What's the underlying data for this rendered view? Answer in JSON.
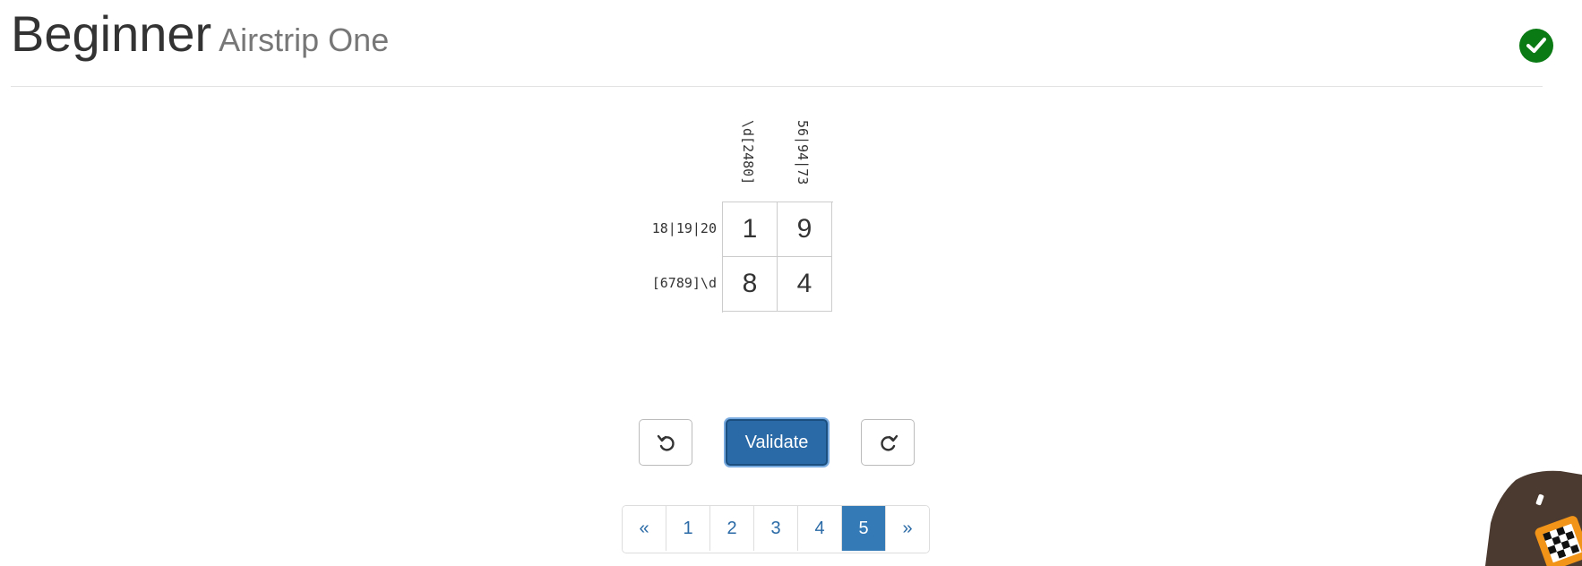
{
  "header": {
    "title": "Beginner",
    "subtitle": "Airstrip One",
    "status_icon": "check-circle-icon",
    "status_color": "#0a7a14"
  },
  "puzzle": {
    "col_clues": [
      "\\d[2480]",
      "56|94|73"
    ],
    "row_clues": [
      "18|19|20",
      "[6789]\\d"
    ],
    "cells": [
      [
        "1",
        "9"
      ],
      [
        "8",
        "4"
      ]
    ]
  },
  "controls": {
    "undo_icon": "undo-icon",
    "validate_label": "Validate",
    "redo_icon": "redo-icon"
  },
  "pagination": {
    "prev": "«",
    "pages": [
      "1",
      "2",
      "3",
      "4",
      "5"
    ],
    "active": "5",
    "next": "»"
  },
  "colors": {
    "primary": "#337ab7",
    "link": "#2a6aa6"
  }
}
